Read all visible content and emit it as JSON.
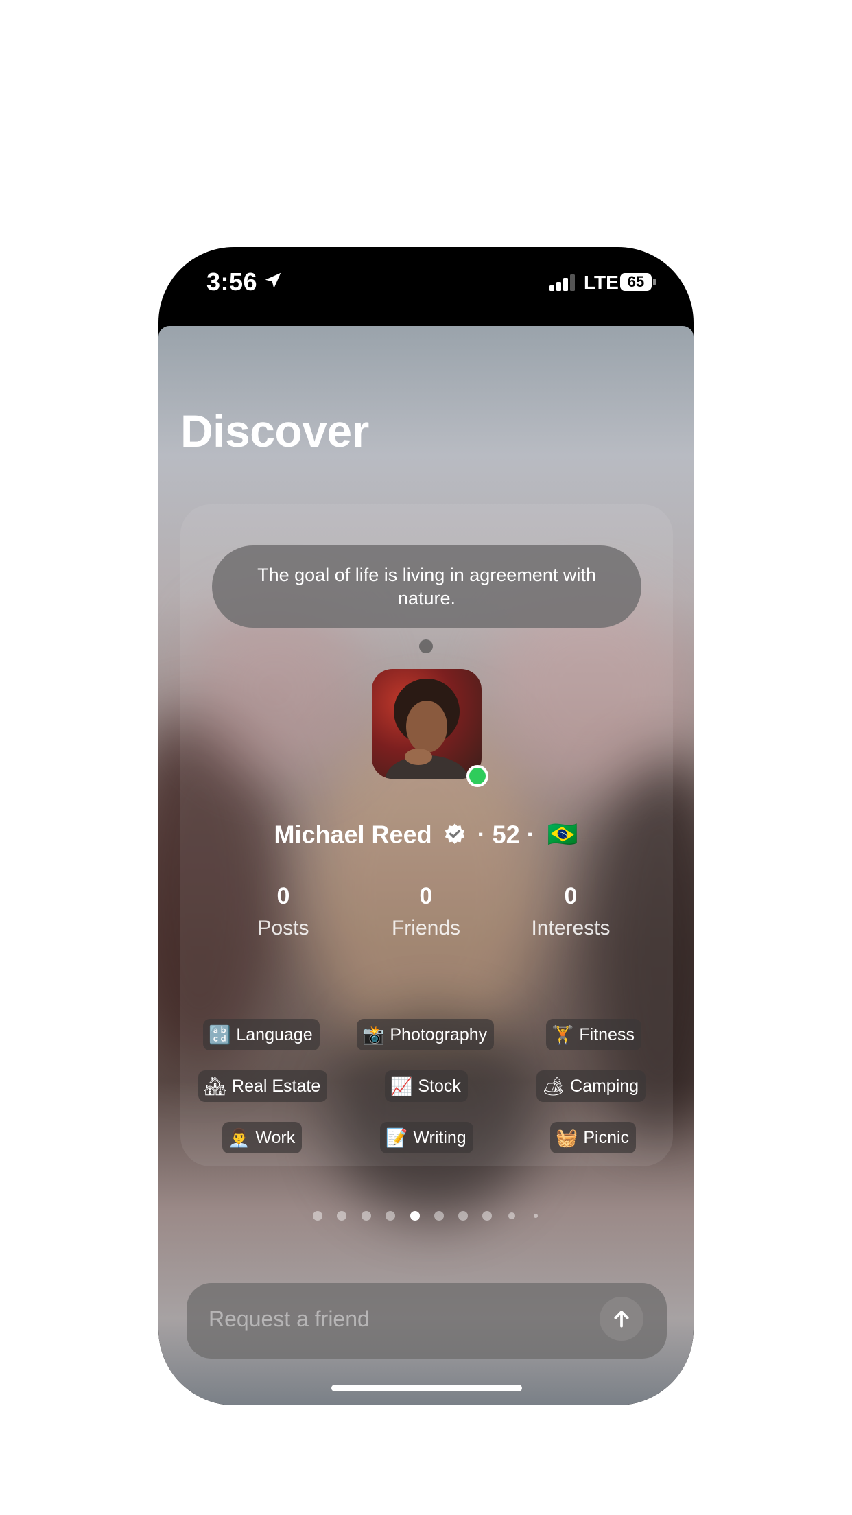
{
  "status_bar": {
    "time": "3:56",
    "network": "LTE",
    "battery": "65"
  },
  "page": {
    "title": "Discover"
  },
  "profile": {
    "quote": "The goal of life is living in agreement with nature.",
    "name": "Michael Reed",
    "age_text": "· 52 ·",
    "flag": "🇧🇷",
    "online_color": "#2ecc5b",
    "stats": [
      {
        "value": "0",
        "label": "Posts"
      },
      {
        "value": "0",
        "label": "Friends"
      },
      {
        "value": "0",
        "label": "Interests"
      }
    ],
    "interests": [
      {
        "emoji": "🔡",
        "label": "Language"
      },
      {
        "emoji": "📸",
        "label": "Photography"
      },
      {
        "emoji": "🏋",
        "label": "Fitness"
      },
      {
        "emoji": "🏘",
        "label": "Real Estate"
      },
      {
        "emoji": "📈",
        "label": "Stock"
      },
      {
        "emoji": "🏕",
        "label": "Camping"
      },
      {
        "emoji": "👨‍💼",
        "label": "Work"
      },
      {
        "emoji": "📝",
        "label": "Writing"
      },
      {
        "emoji": "🧺",
        "label": "Picnic"
      }
    ]
  },
  "pager": {
    "count": 10,
    "active_index": 4
  },
  "request": {
    "placeholder": "Request a friend"
  }
}
